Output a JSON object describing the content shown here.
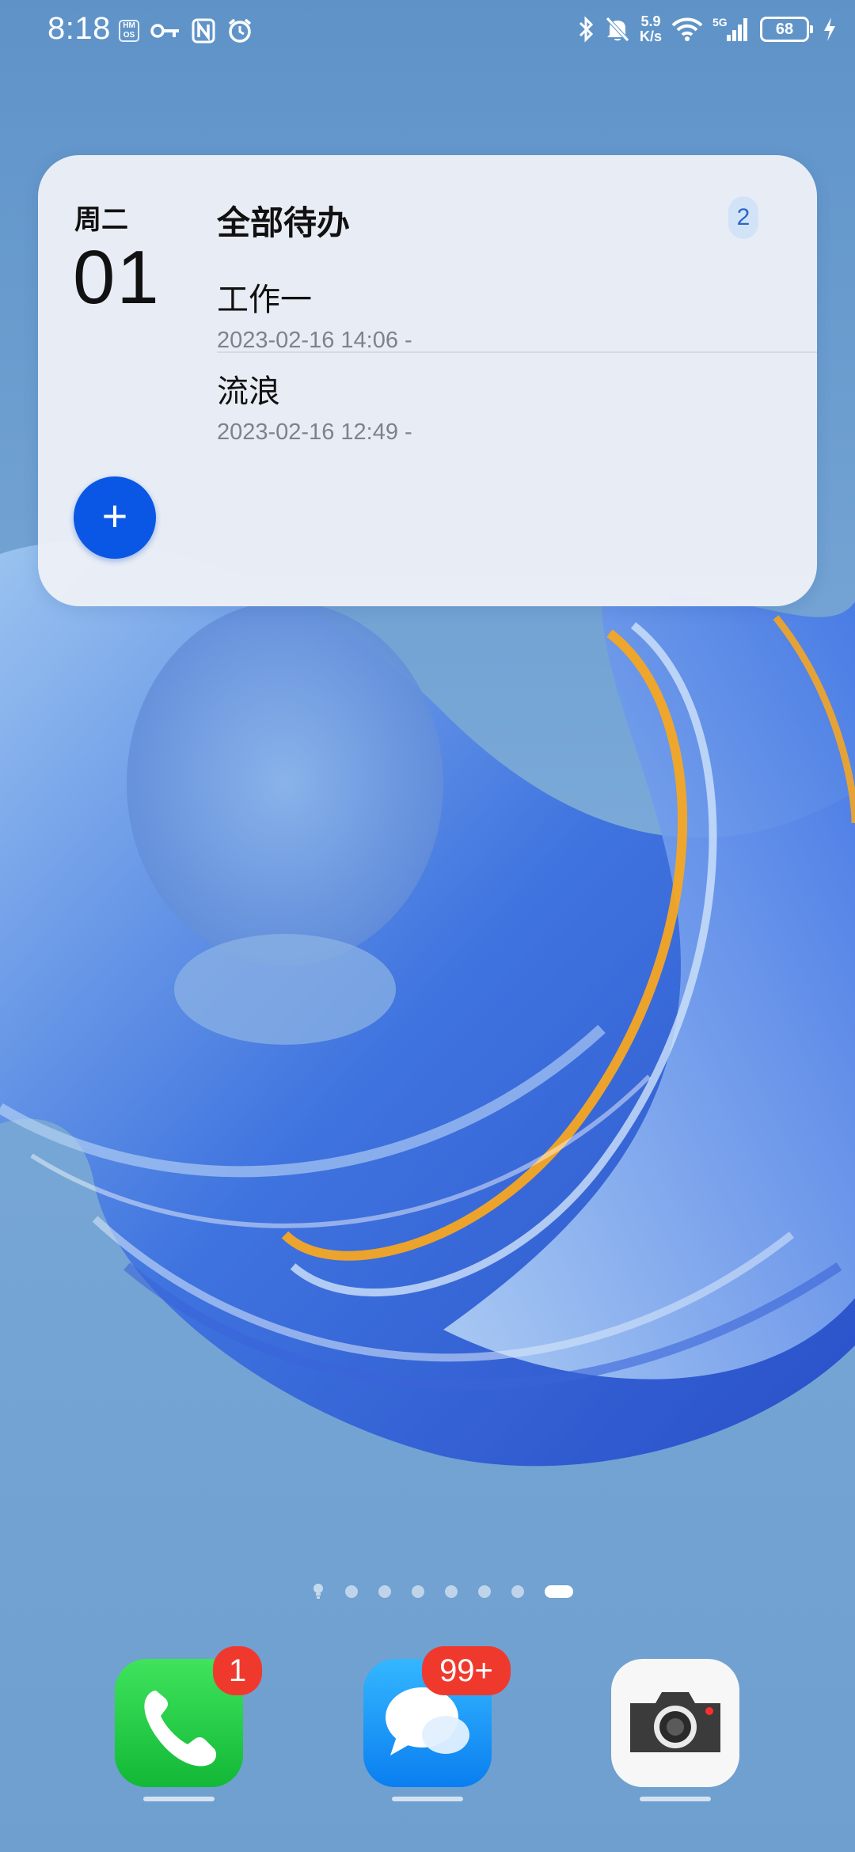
{
  "status_bar": {
    "time": "8:18",
    "hmos_label": "HM OS",
    "network_speed_value": "5.9",
    "network_speed_unit": "K/s",
    "network_type": "5G",
    "battery_level": "68",
    "left_icons": [
      "hmos-icon",
      "key-icon",
      "nfc-icon",
      "alarm-icon"
    ],
    "right_icons": [
      "bluetooth-icon",
      "mute-icon",
      "wifi-icon",
      "signal-icon",
      "battery-icon",
      "charging-icon"
    ]
  },
  "todo_widget": {
    "weekday": "周二",
    "day": "01",
    "title": "全部待办",
    "count": "2",
    "tasks": [
      {
        "title": "工作一",
        "time": "2023-02-16 14:06 -"
      },
      {
        "title": "流浪",
        "time": "2023-02-16 12:49 -"
      }
    ],
    "add_label": "+"
  },
  "page_indicator": {
    "pages": 8,
    "active_page": 8,
    "first_icon": "lightbulb-icon"
  },
  "dock": {
    "apps": [
      {
        "name": "phone",
        "icon": "phone-icon",
        "badge": "1",
        "color": "#1fc93f"
      },
      {
        "name": "messages",
        "icon": "chat-bubble-icon",
        "badge": "99+",
        "color": "#1a8df5"
      },
      {
        "name": "camera",
        "icon": "camera-icon",
        "badge": "",
        "color": "#f7f7f7"
      }
    ]
  },
  "colors": {
    "accent": "#0a57e6",
    "badge": "#f0392d",
    "widget_bg": "#eceff6"
  }
}
